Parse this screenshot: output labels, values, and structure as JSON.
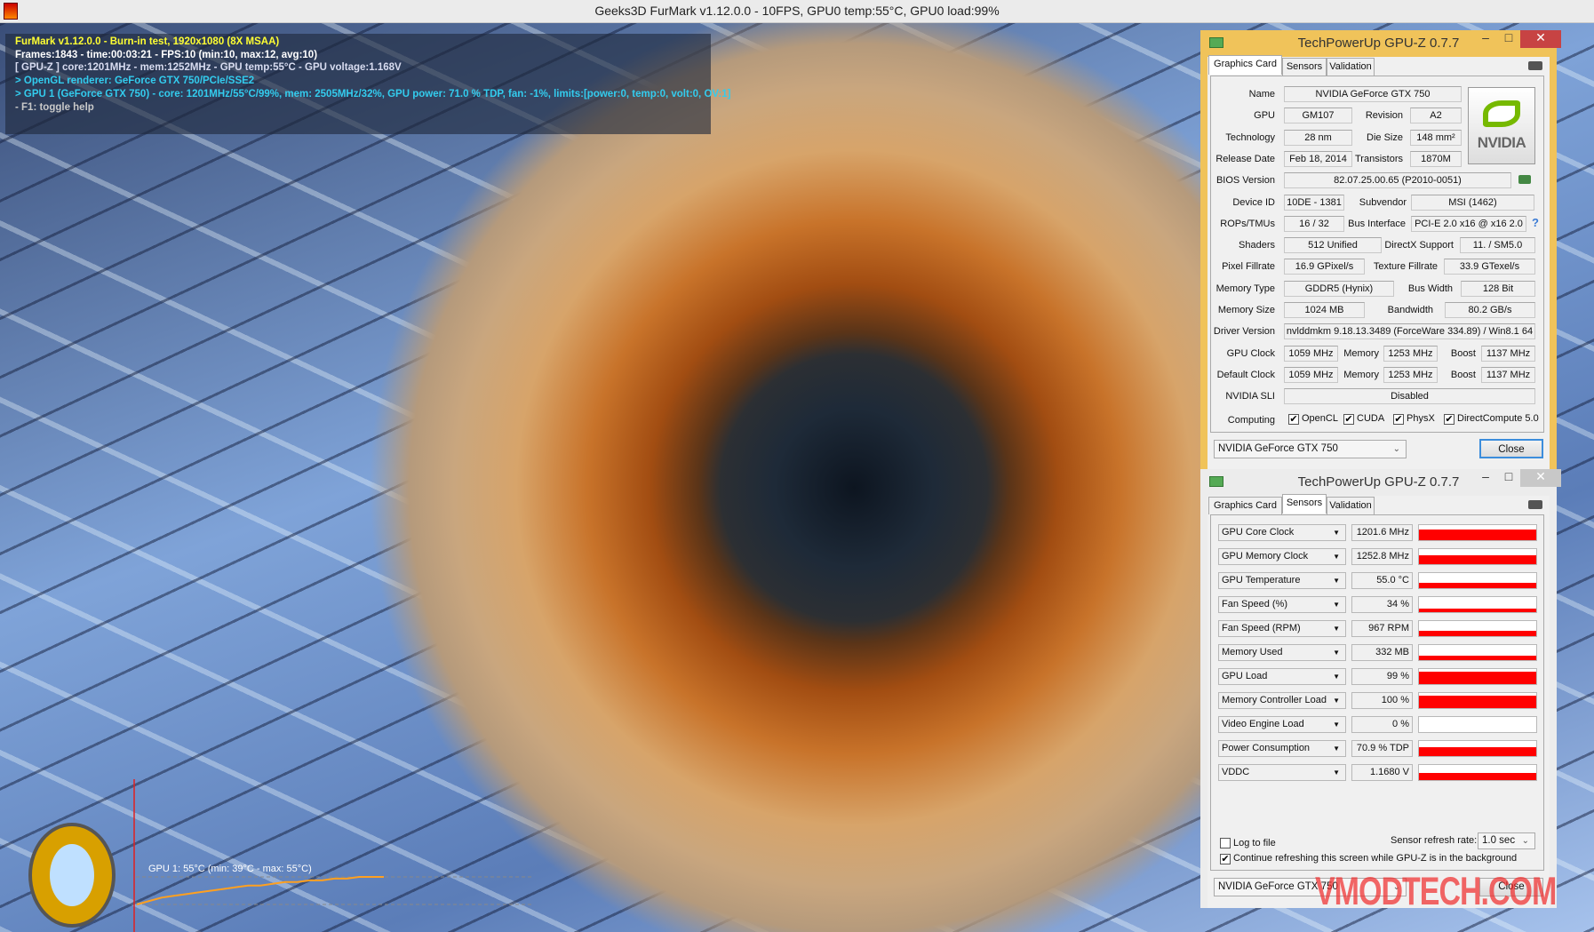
{
  "titlebar": {
    "title": "Geeks3D FurMark v1.12.0.0 - 10FPS, GPU0 temp:55°C, GPU0 load:99%"
  },
  "overlay": {
    "lines": [
      {
        "text": "FurMark v1.12.0.0 - Burn-in test, 1920x1080 (8X MSAA)",
        "color": "#ffff33"
      },
      {
        "text": "Frames:1843 - time:00:03:21 - FPS:10 (min:10, max:12, avg:10)",
        "color": "#ffffff"
      },
      {
        "text": "[ GPU-Z ] core:1201MHz - mem:1252MHz - GPU temp:55°C - GPU voltage:1.168V",
        "color": "#d8dcf0"
      },
      {
        "text": "> OpenGL renderer: GeForce GTX 750/PCIe/SSE2",
        "color": "#33ccee"
      },
      {
        "text": "> GPU 1 (GeForce GTX 750) - core: 1201MHz/55°C/99%, mem: 2505MHz/32%, GPU power: 71.0 % TDP, fan: -1%, limits:[power:0, temp:0, volt:0, OV:1]",
        "color": "#33ccee"
      },
      {
        "text": "- F1: toggle help",
        "color": "#c8c8c8"
      }
    ]
  },
  "temp_graph": {
    "label": "GPU 1: 55°C (min: 39°C - max: 55°C)",
    "min": 39,
    "max": 55,
    "history": [
      39,
      41,
      43,
      44,
      45,
      46,
      47,
      48,
      49,
      50,
      50,
      51,
      52,
      52,
      53,
      53,
      54,
      54,
      55,
      55,
      55
    ],
    "line_color": "#ffa020"
  },
  "gpuz1": {
    "title": "TechPowerUp GPU-Z 0.7.7",
    "tabs": [
      "Graphics Card",
      "Sensors",
      "Validation"
    ],
    "active_tab": "Graphics Card",
    "rows": [
      [
        {
          "label": "Name",
          "value": "NVIDIA GeForce GTX 750"
        }
      ],
      [
        {
          "label": "GPU",
          "value": "GM107"
        },
        {
          "label": "Revision",
          "value": "A2"
        }
      ],
      [
        {
          "label": "Technology",
          "value": "28 nm"
        },
        {
          "label": "Die Size",
          "value": "148 mm²"
        }
      ],
      [
        {
          "label": "Release Date",
          "value": "Feb 18, 2014"
        },
        {
          "label": "Transistors",
          "value": "1870M"
        }
      ],
      [
        {
          "label": "BIOS Version",
          "value": "82.07.25.00.65 (P2010-0051)"
        }
      ],
      [
        {
          "label": "Device ID",
          "value": "10DE - 1381"
        },
        {
          "label": "Subvendor",
          "value": "MSI (1462)"
        }
      ],
      [
        {
          "label": "ROPs/TMUs",
          "value": "16 / 32"
        },
        {
          "label": "Bus Interface",
          "value": "PCI-E 2.0 x16 @ x16 2.0"
        }
      ],
      [
        {
          "label": "Shaders",
          "value": "512 Unified"
        },
        {
          "label": "DirectX Support",
          "value": "11. / SM5.0"
        }
      ],
      [
        {
          "label": "Pixel Fillrate",
          "value": "16.9 GPixel/s"
        },
        {
          "label": "Texture Fillrate",
          "value": "33.9 GTexel/s"
        }
      ],
      [
        {
          "label": "Memory Type",
          "value": "GDDR5 (Hynix)"
        },
        {
          "label": "Bus Width",
          "value": "128 Bit"
        }
      ],
      [
        {
          "label": "Memory Size",
          "value": "1024 MB"
        },
        {
          "label": "Bandwidth",
          "value": "80.2 GB/s"
        }
      ],
      [
        {
          "label": "Driver Version",
          "value": "nvlddmkm 9.18.13.3489 (ForceWare 334.89) / Win8.1 64"
        }
      ],
      [
        {
          "label": "GPU Clock",
          "value": "1059 MHz"
        },
        {
          "label": "Memory",
          "value": "1253 MHz"
        },
        {
          "label": "Boost",
          "value": "1137 MHz"
        }
      ],
      [
        {
          "label": "Default Clock",
          "value": "1059 MHz"
        },
        {
          "label": "Memory",
          "value": "1253 MHz"
        },
        {
          "label": "Boost",
          "value": "1137 MHz"
        }
      ],
      [
        {
          "label": "NVIDIA SLI",
          "value": "Disabled"
        }
      ]
    ],
    "computing": {
      "label": "Computing",
      "items": [
        {
          "label": "OpenCL",
          "checked": true
        },
        {
          "label": "CUDA",
          "checked": true
        },
        {
          "label": "PhysX",
          "checked": true
        },
        {
          "label": "DirectCompute 5.0",
          "checked": true
        }
      ]
    },
    "gpu_select": "NVIDIA GeForce GTX 750",
    "close": "Close",
    "logo": "NVIDIA",
    "help": "?"
  },
  "gpuz2": {
    "title": "TechPowerUp GPU-Z 0.7.7",
    "tabs": [
      "Graphics Card",
      "Sensors",
      "Validation"
    ],
    "active_tab": "Sensors",
    "sensors": [
      {
        "name": "GPU Core Clock",
        "value": "1201.6 MHz",
        "level": 0.8
      },
      {
        "name": "GPU Memory Clock",
        "value": "1252.8 MHz",
        "level": 0.7
      },
      {
        "name": "GPU Temperature",
        "value": "55.0 °C",
        "level": 0.4
      },
      {
        "name": "Fan Speed (%)",
        "value": "34 %",
        "level": 0.3
      },
      {
        "name": "Fan Speed (RPM)",
        "value": "967 RPM",
        "level": 0.4
      },
      {
        "name": "Memory Used",
        "value": "332 MB",
        "level": 0.32
      },
      {
        "name": "GPU Load",
        "value": "99 %",
        "level": 0.99
      },
      {
        "name": "Memory Controller Load",
        "value": "100 %",
        "level": 1.0
      },
      {
        "name": "Video Engine Load",
        "value": "0 %",
        "level": 0
      },
      {
        "name": "Power Consumption",
        "value": "70.9 % TDP",
        "level": 0.71
      },
      {
        "name": "VDDC",
        "value": "1.1680 V",
        "level": 0.55
      }
    ],
    "log_to_file": {
      "label": "Log to file",
      "checked": false
    },
    "refresh_label": "Sensor refresh rate:",
    "refresh_value": "1.0 sec",
    "continue_refresh": {
      "label": "Continue refreshing this screen while GPU-Z is in the background",
      "checked": true
    },
    "gpu_select": "NVIDIA GeForce GTX 750",
    "close": "Close"
  },
  "watermark": "VMODTECH.COM",
  "colors": {
    "active_border": "#f0c35a",
    "sensor_graph": "#ff0000",
    "close_button": "#c74343"
  }
}
